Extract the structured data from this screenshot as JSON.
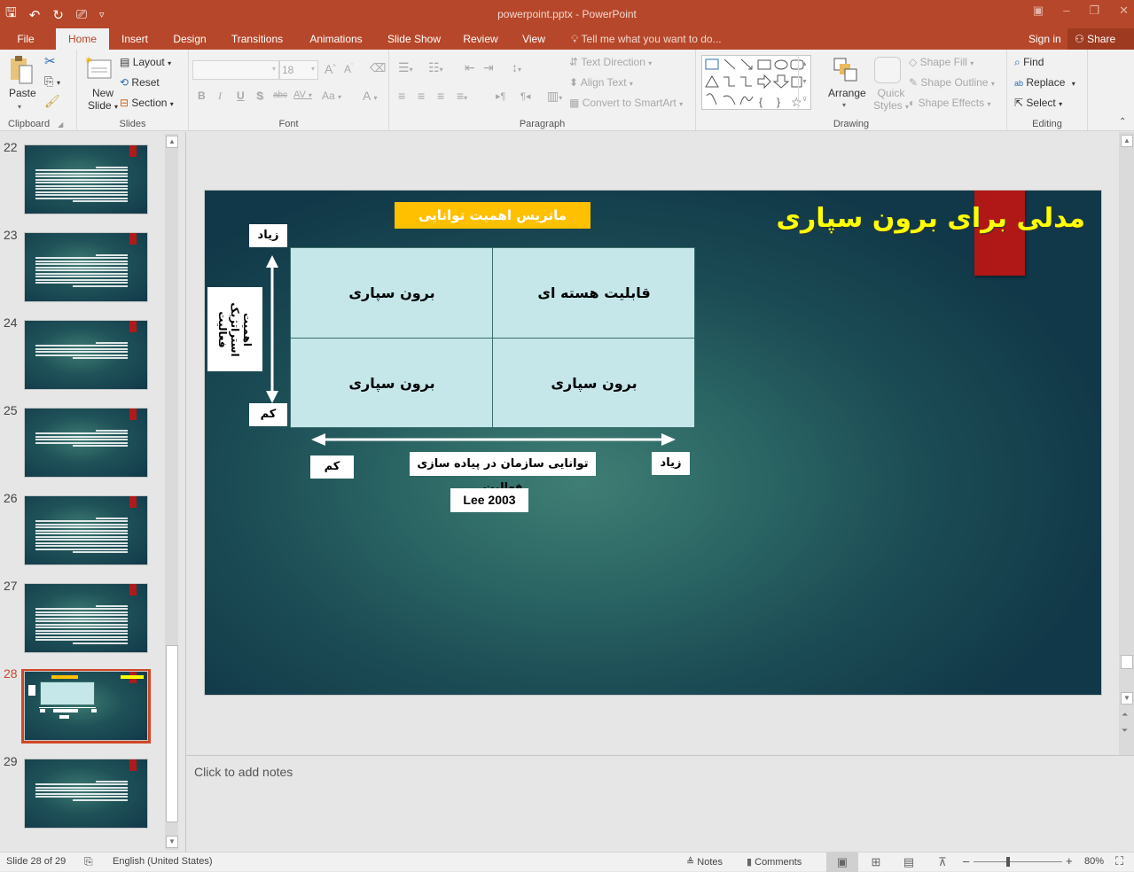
{
  "window": {
    "title": "powerpoint.pptx - PowerPoint",
    "qat": [
      {
        "name": "save-icon",
        "glyph": "🖫"
      },
      {
        "name": "undo-icon",
        "glyph": "↶"
      },
      {
        "name": "redo-icon",
        "glyph": "↻"
      },
      {
        "name": "start-presentation-icon",
        "glyph": "⎚"
      },
      {
        "name": "customize-qat-icon",
        "glyph": "▿"
      }
    ],
    "controls": {
      "ribbon_options": "▣",
      "minimize": "–",
      "restore": "❐",
      "close": "✕"
    }
  },
  "tabs": [
    {
      "label": "File",
      "active": false
    },
    {
      "label": "Home",
      "active": true
    },
    {
      "label": "Insert",
      "active": false
    },
    {
      "label": "Design",
      "active": false
    },
    {
      "label": "Transitions",
      "active": false
    },
    {
      "label": "Animations",
      "active": false
    },
    {
      "label": "Slide Show",
      "active": false
    },
    {
      "label": "Review",
      "active": false
    },
    {
      "label": "View",
      "active": false
    }
  ],
  "tell_me": "Tell me what you want to do...",
  "sign_in": "Sign in",
  "share": "Share",
  "ribbon": {
    "clipboard": {
      "label": "Clipboard",
      "paste": "Paste"
    },
    "slides": {
      "label": "Slides",
      "new_slide_1": "New",
      "new_slide_2": "Slide",
      "layout": "Layout",
      "reset": "Reset",
      "section": "Section"
    },
    "font": {
      "label": "Font",
      "font_name": "",
      "font_size": "18",
      "bold": "B",
      "italic": "I",
      "underline": "U",
      "shadow": "S",
      "strike": "abc",
      "spacing": "AV",
      "case": "Aa",
      "color": "A",
      "grow": "A",
      "shrink": "A"
    },
    "paragraph": {
      "label": "Paragraph",
      "text_direction": "Text Direction",
      "align_text": "Align Text",
      "convert_smartart": "Convert to SmartArt"
    },
    "drawing": {
      "label": "Drawing",
      "arrange": "Arrange",
      "quick_styles_1": "Quick",
      "quick_styles_2": "Styles",
      "shape_fill": "Shape Fill",
      "shape_outline": "Shape Outline",
      "shape_effects": "Shape Effects"
    },
    "editing": {
      "label": "Editing",
      "find": "Find",
      "replace": "Replace",
      "select": "Select"
    }
  },
  "thumbnails": [
    {
      "number": "22",
      "lines": 12,
      "active": false
    },
    {
      "number": "23",
      "lines": 11,
      "active": false
    },
    {
      "number": "24",
      "lines": 6,
      "active": false
    },
    {
      "number": "25",
      "lines": 6,
      "active": false
    },
    {
      "number": "26",
      "lines": 12,
      "active": false
    },
    {
      "number": "27",
      "lines": 13,
      "active": false
    },
    {
      "number": "28",
      "lines": 0,
      "active": true
    },
    {
      "number": "29",
      "lines": 7,
      "active": false
    }
  ],
  "slide": {
    "title": "مدلی برای برون سپاری",
    "matrix_heading": "ماتریس اهمیت توانایی",
    "cells": {
      "top_right": "قابلیت هسته ای",
      "top_left": "برون سپاری",
      "bottom_right": "برون سپاری",
      "bottom_left": "برون سپاری"
    },
    "y_axis": {
      "high": "زیاد",
      "low": "کم",
      "label": "اهمیت استراتژیک فعالیت"
    },
    "x_axis": {
      "high": "زیاد",
      "low": "کم",
      "label": "توانایی سازمان در پیاده سازی فعالیت"
    },
    "citation": "Lee 2003"
  },
  "notes": {
    "placeholder": "Click to add notes"
  },
  "status": {
    "slide_info": "Slide 28 of 29",
    "language": "English (United States)",
    "notes": "Notes",
    "comments": "Comments",
    "zoom": "80%",
    "zoom_level_percent": 80
  }
}
